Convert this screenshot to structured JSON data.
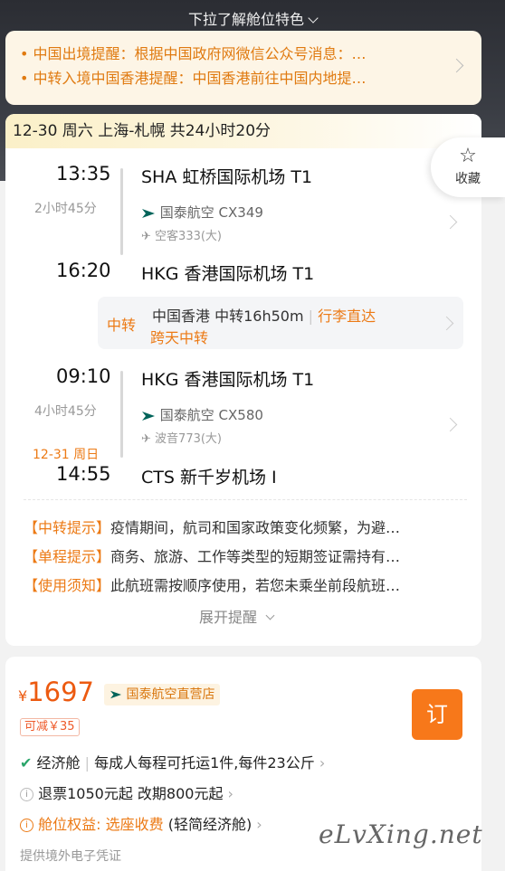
{
  "header": {
    "pulldown_label": "下拉了解舱位特色"
  },
  "notices": [
    {
      "text": "• 中国出境提醒：根据中国政府网微信公众号消息：…"
    },
    {
      "text": "• 中转入境中国香港提醒：中国香港前往中国内地提…"
    }
  ],
  "trip": {
    "summary": "12-30 周六 上海-札幌 共24小时20分",
    "favorite_label": "收藏",
    "favorite_icon": "star-outline-icon",
    "segments": [
      {
        "dep_time": "13:35",
        "dep_airport": "SHA 虹桥国际机场 T1",
        "duration": "2小时45分",
        "airline": "国泰航空 CX349",
        "aircraft": "空客333(大)",
        "arr_time": "16:20",
        "arr_airport": "HKG 香港国际机场 T1"
      },
      {
        "dep_time": "09:10",
        "dep_airport": "HKG 香港国际机场 T1",
        "duration": "4小时45分",
        "airline": "国泰航空 CX580",
        "aircraft": "波音773(大)",
        "arr_date": "12-31 周日",
        "arr_time": "14:55",
        "arr_airport": "CTS 新千岁机场 I"
      }
    ],
    "transfer": {
      "tag": "中转",
      "info": "中国香港  中转16h50m",
      "baggage": "行李直达",
      "overnight": "跨天中转"
    },
    "tips": [
      {
        "tag": "【中转提示】",
        "text": "疫情期间，航司和国家政策变化频繁，为避…"
      },
      {
        "tag": "【单程提示】",
        "text": "商务、旅游、工作等类型的短期签证需持有…"
      },
      {
        "tag": "【使用须知】",
        "text": "此航班需按顺序使用，若您未乘坐前段航班…"
      }
    ],
    "expand_label": "展开提醒"
  },
  "offer": {
    "currency": "¥",
    "price": "1697",
    "store_label": "国泰航空直营店",
    "discount": "可减￥35",
    "book_label": "订",
    "cabin": "经济舱",
    "baggage_rule": "每成人每程可托运1件,每件23公斤",
    "refund": "退票1050元起 改期800元起",
    "perk_label": "舱位权益:",
    "perk_value": "选座收费",
    "perk_note": "(轻简经济舱)",
    "voucher": "提供境外电子凭证"
  },
  "watermark": "eLvXing.net",
  "colors": {
    "accent_orange": "#ec7a15",
    "price_red": "#ec5a10",
    "cathay_green": "#00645a",
    "book_bg": "#f7781a"
  }
}
